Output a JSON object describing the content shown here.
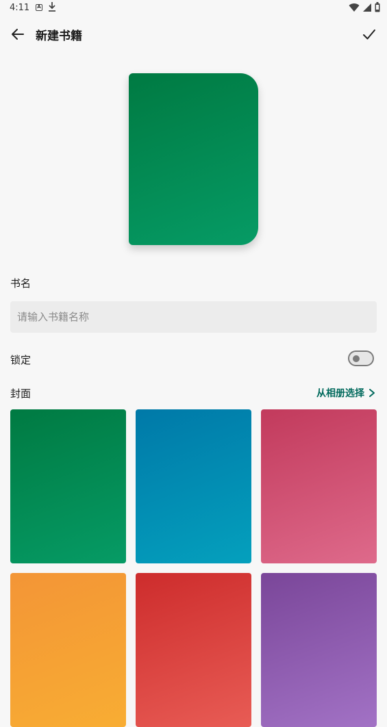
{
  "status_bar": {
    "time": "4:11",
    "icons": [
      "notification-a-icon",
      "download-icon",
      "wifi-icon",
      "signal-icon",
      "battery-icon"
    ]
  },
  "app_bar": {
    "title": "新建书籍",
    "back_icon": "arrow-back-icon",
    "confirm_icon": "check-icon"
  },
  "preview": {
    "cover_color_start": "#007a42",
    "cover_color_end": "#069b65"
  },
  "form": {
    "name_label": "书名",
    "name_value": "",
    "name_placeholder": "请输入书籍名称",
    "lock_label": "锁定",
    "lock_enabled": false,
    "cover_label": "封面",
    "album_link": "从相册选择"
  },
  "cover_options": [
    {
      "name": "green",
      "start": "#007a42",
      "end": "#069b65"
    },
    {
      "name": "blue",
      "start": "#0079a8",
      "end": "#04a0bd"
    },
    {
      "name": "pink",
      "start": "#c23a5c",
      "end": "#de6a8b"
    },
    {
      "name": "orange",
      "start": "#f39536",
      "end": "#f8ad33"
    },
    {
      "name": "red",
      "start": "#cd2c2c",
      "end": "#e85c55"
    },
    {
      "name": "purple",
      "start": "#7a4699",
      "end": "#a272c5"
    }
  ],
  "colors": {
    "accent": "#00695c",
    "background": "#f7f7f7",
    "input_background": "#ececec"
  }
}
